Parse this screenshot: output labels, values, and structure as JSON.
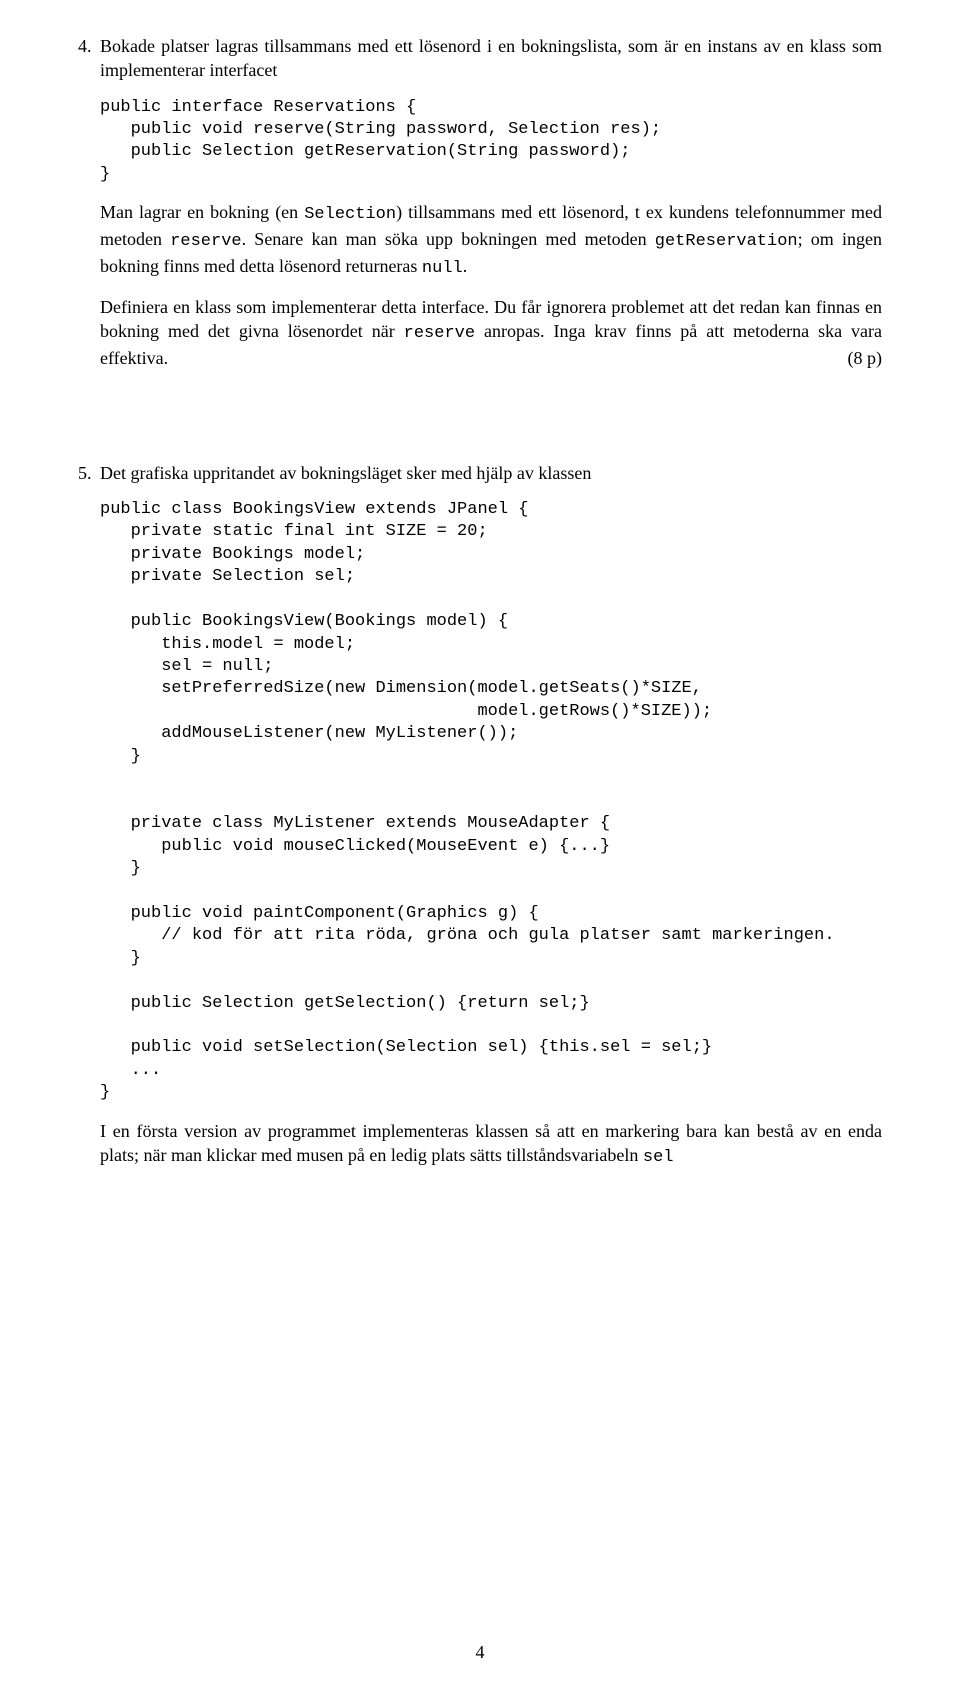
{
  "q4": {
    "num": "4.",
    "p1a": "Bokade platser lagras tillsammans med ett lösenord i en bokningslista, som är en instans av en klass som implementerar interfacet",
    "code1": "public interface Reservations {\n   public void reserve(String password, Selection res);\n   public Selection getReservation(String password);\n}",
    "p2a": "Man lagrar en bokning (en ",
    "p2b": ") tillsammans med ett lösenord, t ex kundens telefonnummer med metoden ",
    "p2c": ". Senare kan man söka upp bokningen med metoden ",
    "p2d": "; om ingen bokning finns med detta lösenord returneras ",
    "p2e": ".",
    "mono_selection": "Selection",
    "mono_reserve": "reserve",
    "mono_getres": "getReservation",
    "mono_null": "null",
    "p3a": "Definiera en klass som implementerar detta interface. Du får ignorera problemet att det redan kan finnas en bokning med det givna lösenordet när ",
    "p3b": " anropas. Inga krav finns på att metoderna ska vara effektiva.",
    "mono_reserve2": "reserve",
    "score": "(8 p)"
  },
  "q5": {
    "num": "5.",
    "p1": "Det grafiska uppritandet av bokningsläget sker med hjälp av klassen",
    "code1": "public class BookingsView extends JPanel {\n   private static final int SIZE = 20;\n   private Bookings model;\n   private Selection sel;\n\n   public BookingsView(Bookings model) {\n      this.model = model;\n      sel = null;\n      setPreferredSize(new Dimension(model.getSeats()*SIZE,\n                                     model.getRows()*SIZE));\n      addMouseListener(new MyListener());\n   }\n\n\n   private class MyListener extends MouseAdapter {\n      public void mouseClicked(MouseEvent e) {...}\n   }\n\n   public void paintComponent(Graphics g) {\n      // kod för att rita röda, gröna och gula platser samt markeringen.\n   }\n\n   public Selection getSelection() {return sel;}\n\n   public void setSelection(Selection sel) {this.sel = sel;}\n   ...\n}",
    "p2a": "I en första version av programmet implementeras klassen så att en markering bara kan bestå av en enda plats; när man klickar med musen på en ledig plats sätts tillståndsvariabeln ",
    "mono_sel": "sel"
  },
  "page_number": "4"
}
